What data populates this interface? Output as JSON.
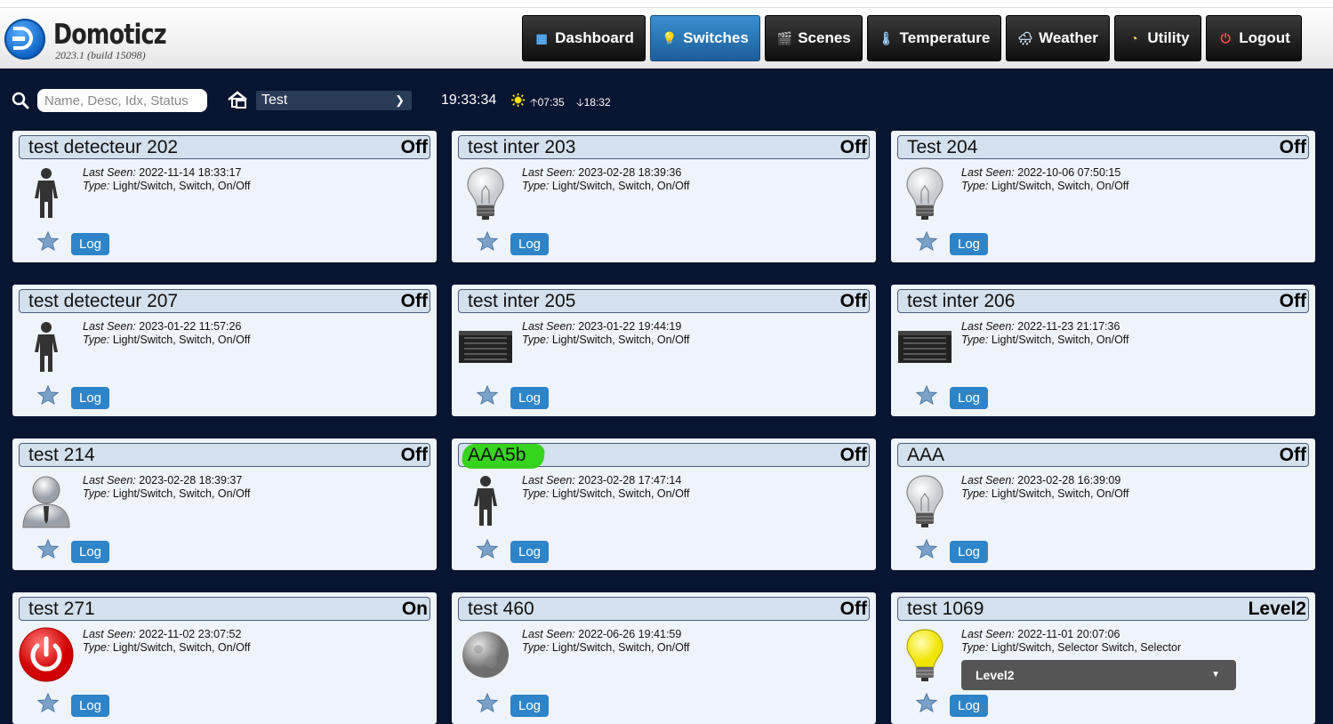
{
  "app": {
    "name": "Domoticz",
    "build": "2023.1 (build 15098)"
  },
  "nav": [
    {
      "label": "Dashboard",
      "icon": "dashboard-icon"
    },
    {
      "label": "Switches",
      "icon": "lightbulb-icon",
      "active": true
    },
    {
      "label": "Scenes",
      "icon": "clapperboard-icon"
    },
    {
      "label": "Temperature",
      "icon": "thermometer-icon"
    },
    {
      "label": "Weather",
      "icon": "cloud-rain-icon"
    },
    {
      "label": "Utility",
      "icon": "gauge-icon"
    },
    {
      "label": "Logout",
      "icon": "power-icon"
    }
  ],
  "toolbar": {
    "search_placeholder": "Name, Desc, Idx, Status",
    "room": "Test",
    "time": "19:33:34",
    "sunrise": "07:35",
    "sunset": "18:32"
  },
  "labels": {
    "last_seen": "Last Seen:",
    "type": "Type:",
    "log": "Log"
  },
  "devices": [
    {
      "name": "test detecteur 202",
      "status": "Off",
      "last_seen": "2022-11-14 18:33:17",
      "type": "Light/Switch, Switch, On/Off",
      "icon": "person-icon"
    },
    {
      "name": "test inter 203",
      "status": "Off",
      "last_seen": "2023-02-28 18:39:36",
      "type": "Light/Switch, Switch, On/Off",
      "icon": "bulb-off-icon"
    },
    {
      "name": "Test 204",
      "status": "Off",
      "last_seen": "2022-10-06 07:50:15",
      "type": "Light/Switch, Switch, On/Off",
      "icon": "bulb-off-icon"
    },
    {
      "name": "test detecteur 207",
      "status": "Off",
      "last_seen": "2023-01-22 11:57:26",
      "type": "Light/Switch, Switch, On/Off",
      "icon": "person-icon"
    },
    {
      "name": "test inter 205",
      "status": "Off",
      "last_seen": "2023-01-22 19:44:19",
      "type": "Light/Switch, Switch, On/Off",
      "icon": "shutter-icon"
    },
    {
      "name": "test inter 206",
      "status": "Off",
      "last_seen": "2022-11-23 21:17:36",
      "type": "Light/Switch, Switch, On/Off",
      "icon": "shutter-icon"
    },
    {
      "name": "test 214",
      "status": "Off",
      "last_seen": "2023-02-28 18:39:37",
      "type": "Light/Switch, Switch, On/Off",
      "icon": "user-avatar-icon"
    },
    {
      "name": "AAA5b",
      "status": "Off",
      "last_seen": "2023-02-28 17:47:14",
      "type": "Light/Switch, Switch, On/Off",
      "icon": "person-icon",
      "highlight": true
    },
    {
      "name": "AAA",
      "status": "Off",
      "last_seen": "2023-02-28 16:39:09",
      "type": "Light/Switch, Switch, On/Off",
      "icon": "bulb-off-icon"
    },
    {
      "name": "test 271",
      "status": "On",
      "last_seen": "2022-11-02 23:07:52",
      "type": "Light/Switch, Switch, On/Off",
      "icon": "power-button-icon"
    },
    {
      "name": "test 460",
      "status": "Off",
      "last_seen": "2022-06-26 19:41:59",
      "type": "Light/Switch, Switch, On/Off",
      "icon": "moon-icon"
    },
    {
      "name": "test 1069",
      "status": "Level2",
      "last_seen": "2022-11-01 20:07:06",
      "type": "Light/Switch, Selector Switch, Selector",
      "icon": "bulb-on-icon",
      "selector": "Level2"
    }
  ],
  "colors": {
    "background": "#071530",
    "card": "#eff3fa",
    "accent": "#2d84c8",
    "active_nav": "#2f7fc0",
    "highlight": "#2ed312"
  }
}
